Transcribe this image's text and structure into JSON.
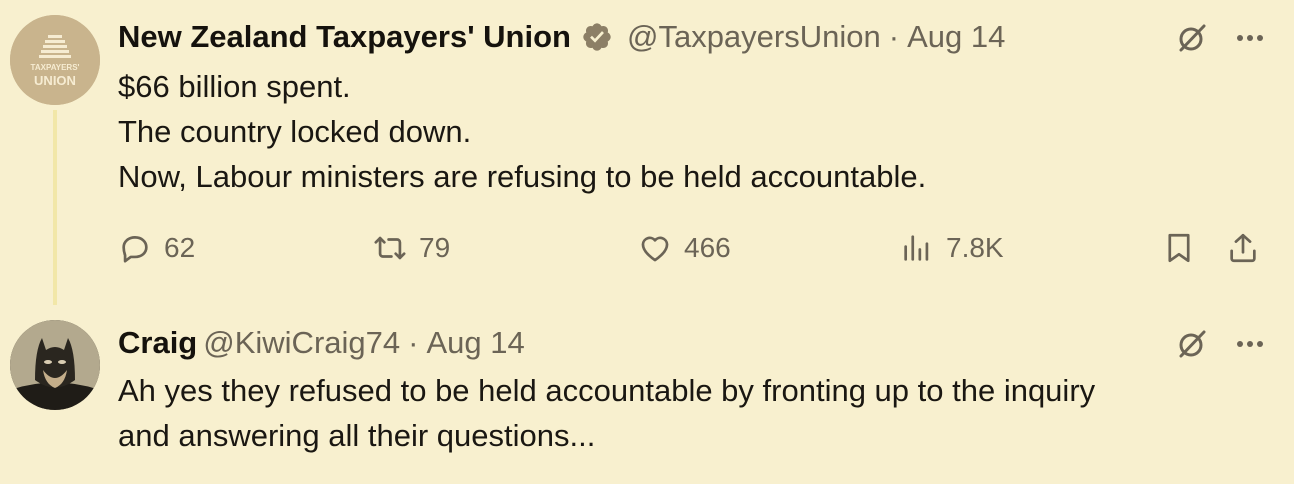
{
  "tweets": [
    {
      "author_name": "New Zealand Taxpayers' Union",
      "verified": true,
      "handle": "@TaxpayersUnion",
      "separator": "·",
      "date": "Aug 14",
      "avatar_logo_text": [
        "TAXPAYERS'",
        "UNION"
      ],
      "lines": [
        "$66 billion spent.",
        "The country locked down.",
        "Now, Labour ministers are refusing to be held accountable."
      ],
      "stats": {
        "replies": "62",
        "retweets": "79",
        "likes": "466",
        "views": "7.8K"
      }
    },
    {
      "author_name": "Craig",
      "verified": false,
      "handle": "@KiwiCraig74",
      "separator": "·",
      "date": "Aug 14",
      "lines": [
        "Ah yes they refused to be held accountable by fronting up to the inquiry",
        "and answering all their questions..."
      ]
    }
  ],
  "icons": {
    "reply": "reply-icon",
    "retweet": "retweet-icon",
    "like": "heart-icon",
    "views": "views-icon",
    "bookmark": "bookmark-icon",
    "share": "share-icon",
    "grok": "grok-icon",
    "more": "more-icon",
    "verified": "verified-badge-icon"
  },
  "colors": {
    "background": "#f8f0cf",
    "text": "#1a1712",
    "muted": "#6b6456",
    "verified_badge": "#8c7f66"
  }
}
